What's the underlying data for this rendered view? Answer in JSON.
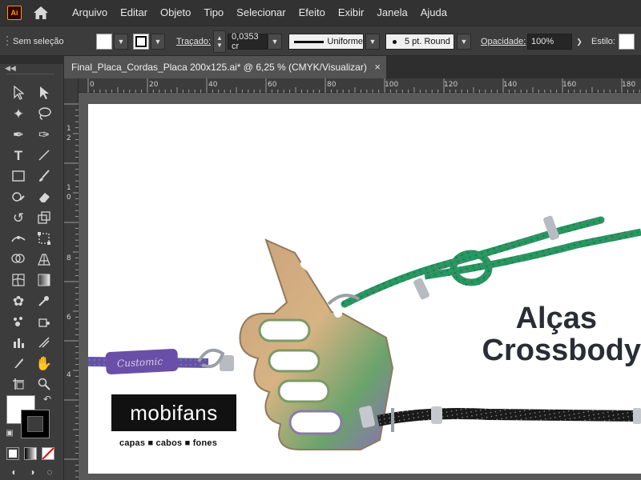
{
  "app": {
    "logo_text": "Ai"
  },
  "menu": [
    "Arquivo",
    "Editar",
    "Objeto",
    "Tipo",
    "Selecionar",
    "Efeito",
    "Exibir",
    "Janela",
    "Ajuda"
  ],
  "control": {
    "selection": "Sem seleção",
    "stroke_label": "Traçado:",
    "stroke_value": "0,0353 cr",
    "profile": "Uniforme",
    "brush": "5 pt. Round",
    "opacity_label": "Opacidade:",
    "opacity_value": "100%",
    "style_label": "Estilo:"
  },
  "document": {
    "tab_title": "Final_Placa_Cordas_Placa 200x125.ai* @ 6,25 % (CMYK/Visualizar)",
    "close": "×"
  },
  "ruler": {
    "top": [
      "0",
      "20",
      "40",
      "60",
      "80",
      "100",
      "120",
      "140",
      "160",
      "180"
    ],
    "left": [
      [
        "1",
        "2"
      ],
      [
        "1",
        "0"
      ],
      [
        "8"
      ],
      [
        "6"
      ],
      [
        "4"
      ]
    ]
  },
  "artwork": {
    "brand": "mobifans",
    "tagline": "capas ■ cabos ■ fones",
    "headline_line1": "Alças",
    "headline_line2": "Crossbody",
    "strap_tag": "Customic"
  },
  "colors": {
    "menubar": "#323232",
    "panel": "#3c3c3c",
    "canvas": "#535353",
    "accent_logo": "#ff9a00",
    "headline": "#2a2d36",
    "cord_green": "#1f9a5c",
    "cord_purple": "#6a4fa8",
    "cord_black": "#1a1a1a",
    "thumb_gradient": [
      "#d4a877",
      "#6aa36b",
      "#8d6fb8"
    ]
  }
}
